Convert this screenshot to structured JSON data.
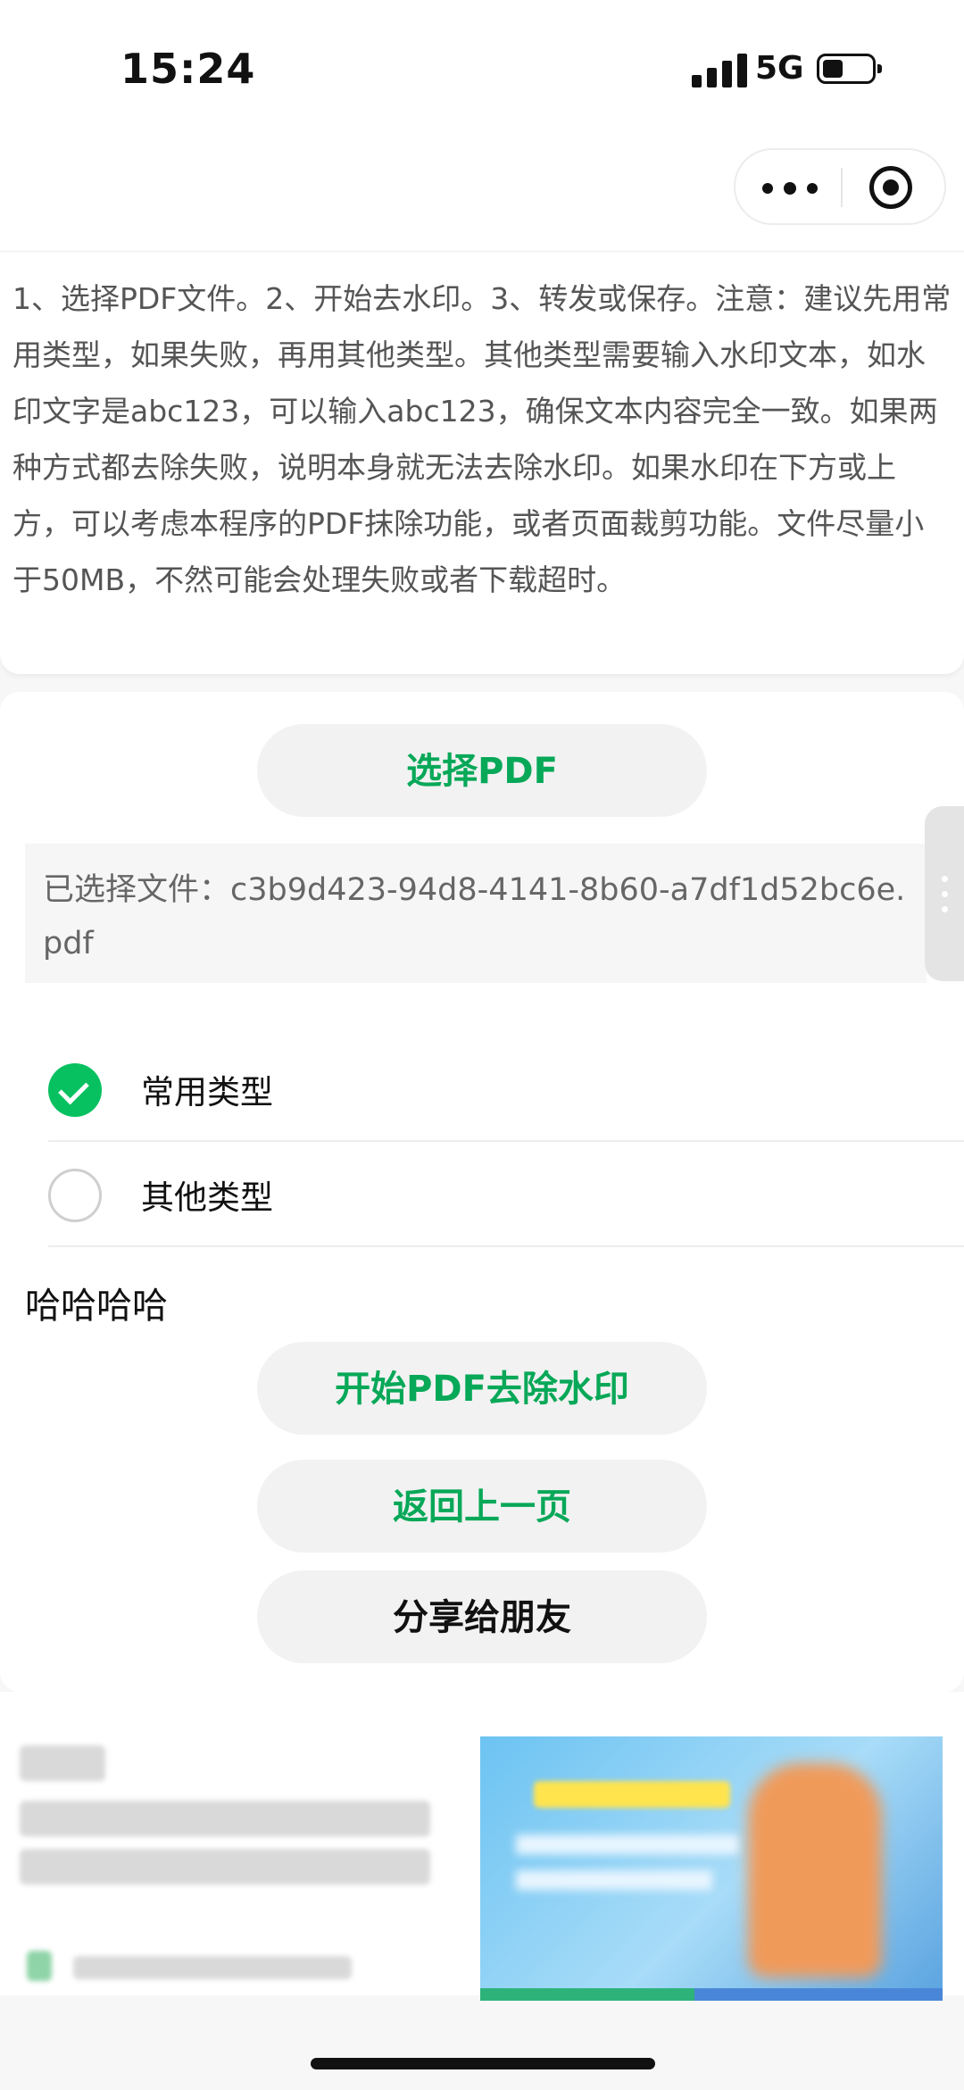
{
  "status_bar": {
    "time": "15:24",
    "network": "5G"
  },
  "instructions": {
    "text": "1、选择PDF文件。2、开始去水印。3、转发或保存。注意：建议先用常用类型，如果失败，再用其他类型。其他类型需要输入水印文本，如水印文字是abc123，可以输入abc123，确保文本内容完全一致。如果两种方式都去除失败，说明本身就无法去除水印。如果水印在下方或上方，可以考虑本程序的PDF抹除功能，或者页面裁剪功能。文件尽量小于50MB，不然可能会处理失败或者下载超时。"
  },
  "main": {
    "select_pdf_label": "选择PDF",
    "selected_file_text": "已选择文件：c3b9d423-94d8-4141-8b60-a7df1d52bc6e.pdf",
    "options": [
      {
        "label": "常用类型",
        "checked": true
      },
      {
        "label": "其他类型",
        "checked": false
      }
    ],
    "hint": "哈哈哈哈",
    "start_label": "开始PDF去除水印",
    "back_label": "返回上一页",
    "share_label": "分享给朋友"
  },
  "colors": {
    "accent": "#07a858",
    "check": "#07c160"
  },
  "icons": [
    "signal-icon",
    "battery-icon",
    "more-icon",
    "close-miniprogram-icon",
    "check-icon"
  ]
}
